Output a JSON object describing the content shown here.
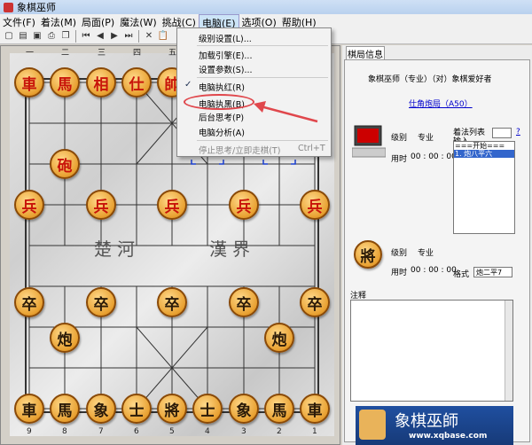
{
  "window": {
    "title": "象棋巫师"
  },
  "menubar": [
    "文件(F)",
    "着法(M)",
    "局面(P)",
    "魔法(W)",
    "挑战(C)",
    "电脑(E)",
    "选项(O)",
    "帮助(H)"
  ],
  "toolbar_icons": [
    "new-icon",
    "open-icon",
    "save-icon",
    "print-icon",
    "copy-icon",
    "first-icon",
    "prev-icon",
    "next-icon",
    "last-icon",
    "stop-icon",
    "paste-icon"
  ],
  "board": {
    "top_coords": [
      "一",
      "二",
      "三",
      "四",
      "五"
    ],
    "bottom_coords": [
      "9",
      "8",
      "7",
      "6",
      "5",
      "4",
      "3",
      "2",
      "1"
    ],
    "river_left": "楚河",
    "river_right": "漢界",
    "pieces": [
      {
        "ch": "車",
        "color": "red"
      },
      {
        "ch": "馬",
        "color": "red"
      },
      {
        "ch": "相",
        "color": "red"
      },
      {
        "ch": "仕",
        "color": "red"
      },
      {
        "ch": "帥",
        "color": "red"
      },
      {
        "ch": "砲",
        "color": "red"
      },
      {
        "ch": "兵",
        "color": "red"
      },
      {
        "ch": "兵",
        "color": "red"
      },
      {
        "ch": "兵",
        "color": "red"
      },
      {
        "ch": "兵",
        "color": "red"
      },
      {
        "ch": "兵",
        "color": "red"
      },
      {
        "ch": "卒",
        "color": "black"
      },
      {
        "ch": "卒",
        "color": "black"
      },
      {
        "ch": "卒",
        "color": "black"
      },
      {
        "ch": "卒",
        "color": "black"
      },
      {
        "ch": "卒",
        "color": "black"
      },
      {
        "ch": "炮",
        "color": "black"
      },
      {
        "ch": "炮",
        "color": "black"
      },
      {
        "ch": "車",
        "color": "black"
      },
      {
        "ch": "馬",
        "color": "black"
      },
      {
        "ch": "象",
        "color": "black"
      },
      {
        "ch": "士",
        "color": "black"
      },
      {
        "ch": "將",
        "color": "black"
      },
      {
        "ch": "士",
        "color": "black"
      },
      {
        "ch": "象",
        "color": "black"
      },
      {
        "ch": "馬",
        "color": "black"
      },
      {
        "ch": "車",
        "color": "black"
      }
    ]
  },
  "panel": {
    "tab": "棋局信息",
    "players_line": "象棋巫师（专业）（对）象棋爱好者",
    "opening_link": "仕角炮局（A50）",
    "top_player": {
      "level_label": "级别",
      "level": "专业",
      "time_label": "用时",
      "time": "00 : 00 : 00"
    },
    "bottom_player": {
      "piece": "將",
      "level_label": "级别",
      "level": "专业",
      "time_label": "用时",
      "time": "00 : 00 : 00"
    },
    "movelist_title": "着法列表",
    "input_label": "输入",
    "help_glyph": "?",
    "moves": [
      "===开始===",
      "1. 炮八平六"
    ],
    "format_label": "格式",
    "format_value": "炮二平7",
    "notes_label": "注释",
    "banner_title": "象棋巫師",
    "banner_url": "www.xqbase.com"
  },
  "computer_menu": {
    "items": [
      {
        "label": "级别设置(L)...",
        "checked": false,
        "disabled": false
      },
      {
        "label": "加载引擎(E)...",
        "checked": false,
        "disabled": false
      },
      {
        "label": "设置参数(S)...",
        "checked": false,
        "disabled": false
      },
      {
        "label": "电脑执红(R)",
        "checked": true,
        "disabled": false
      },
      {
        "label": "电脑执黑(B)",
        "checked": false,
        "disabled": false
      },
      {
        "label": "后台思考(P)",
        "checked": false,
        "disabled": false
      },
      {
        "label": "电脑分析(A)",
        "checked": false,
        "disabled": false
      },
      {
        "label": "停止思考/立即走棋(T)",
        "shortcut": "Ctrl+T",
        "checked": false,
        "disabled": true
      }
    ]
  },
  "colors": {
    "accent_red": "#e0474c",
    "piece_red": "#c8140a",
    "link": "#0000cc",
    "banner": "#1f4fa0"
  }
}
